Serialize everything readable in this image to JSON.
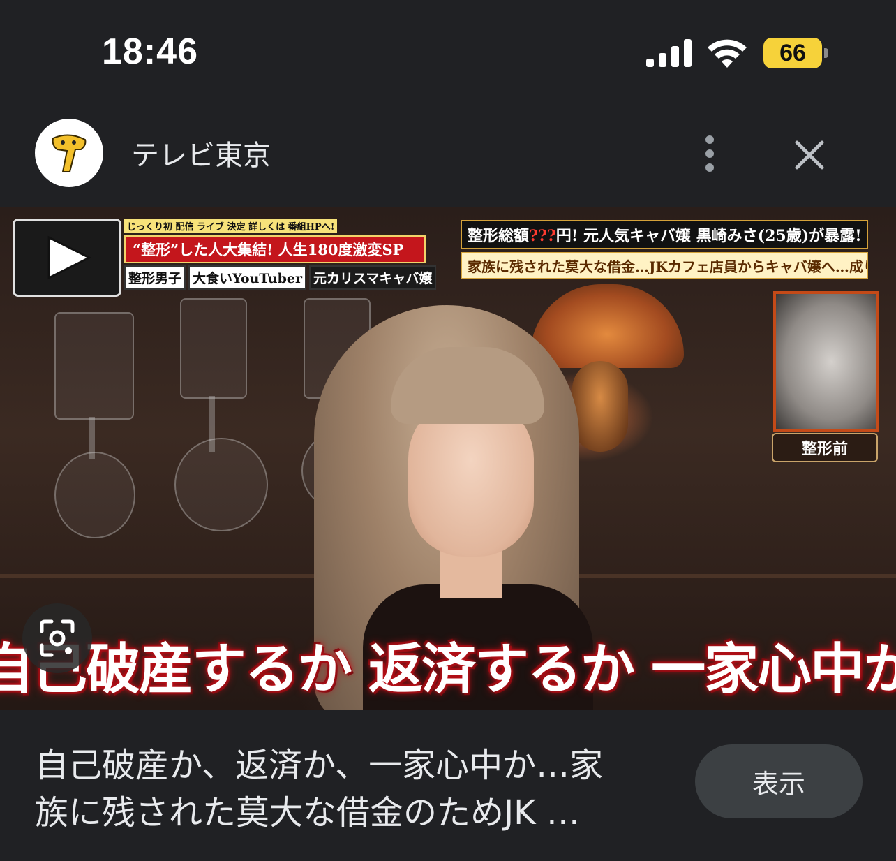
{
  "status_bar": {
    "time": "18:46",
    "battery_level": "66",
    "icons": [
      "cellular-signal-icon",
      "wifi-icon",
      "battery-icon"
    ],
    "battery_color": "#f6d23a"
  },
  "header": {
    "source_name": "テレビ東京",
    "logo_icon": "tv-tokyo-logo",
    "more_icon": "more-vertical-icon",
    "close_icon": "close-icon"
  },
  "preview_image": {
    "caption_left": {
      "badge_line": "じっくり初 配信 ライブ 決定 詳しくは 番組HPへ!",
      "headline": "“整形”した人大集結! 人生180度激変SP",
      "tags": [
        "整形男子",
        "大食いYouTuber",
        "元カリスマキャバ嬢"
      ]
    },
    "caption_right": {
      "line1_a": "整形総額",
      "line1_q": "???",
      "line1_b": "円! 元人気キャバ嬢 黒崎みさ(25歳)が暴露!",
      "line2": "家族に残された莫大な借金…JKカフェ店員からキャバ嬢へ…成り上がり"
    },
    "before_label": "整形前",
    "subtitle": "自己破産するか 返済するか 一家心中か",
    "lens_icon": "google-lens-icon"
  },
  "footer": {
    "title_line1": "自己破産か、返済か、一家心中か…家",
    "title_line2": "族に残された莫大な借金のためJK …",
    "view_button": "表示"
  }
}
